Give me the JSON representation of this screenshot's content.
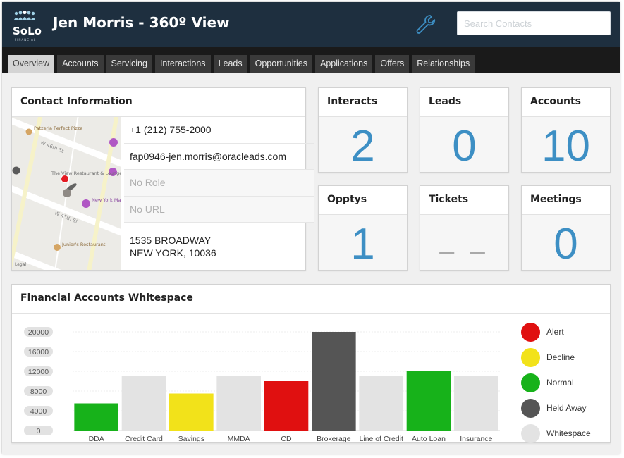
{
  "header": {
    "logo_text": "SoLo",
    "logo_sub": "FINANCIAL",
    "title": "Jen Morris - 360º View",
    "search_placeholder": "Search Contacts"
  },
  "tabs": [
    {
      "label": "Overview",
      "active": true
    },
    {
      "label": "Accounts",
      "active": false
    },
    {
      "label": "Servicing",
      "active": false
    },
    {
      "label": "Interactions",
      "active": false
    },
    {
      "label": "Leads",
      "active": false
    },
    {
      "label": "Opportunities",
      "active": false
    },
    {
      "label": "Applications",
      "active": false
    },
    {
      "label": "Offers",
      "active": false
    },
    {
      "label": "Relationships",
      "active": false
    }
  ],
  "contact": {
    "title": "Contact Information",
    "phone": "+1 (212) 755-2000",
    "email": "fap0946-jen.morris@oracleads.com",
    "role": "No Role",
    "url": "No URL",
    "address_line1": "1535 BROADWAY",
    "address_line2": "NEW YORK, 10036",
    "map": {
      "places": [
        "Patzeria Perfect Pizza",
        "The View Restaurant & Lounge",
        "New York Marriott",
        "Junior's Restaurant"
      ],
      "streets": [
        "W 46th St",
        "W 45th St"
      ],
      "attribution": "Legal"
    }
  },
  "stats": {
    "interacts": {
      "label": "Interacts",
      "value": "2"
    },
    "leads": {
      "label": "Leads",
      "value": "0"
    },
    "accounts": {
      "label": "Accounts",
      "value": "10"
    },
    "opptys": {
      "label": "Opptys",
      "value": "1"
    },
    "tickets": {
      "label": "Tickets",
      "value": "– –"
    },
    "meetings": {
      "label": "Meetings",
      "value": "0"
    }
  },
  "whitespace": {
    "title": "Financial Accounts Whitespace"
  },
  "chart_data": {
    "type": "bar",
    "categories": [
      "DDA",
      "Credit Card",
      "Savings",
      "MMDA",
      "CD",
      "Brokerage",
      "Line of Credit",
      "Auto Loan",
      "Insurance"
    ],
    "values": [
      5500,
      11000,
      7500,
      11000,
      10000,
      20000,
      11000,
      12000,
      11000
    ],
    "statuses": [
      "Normal",
      "Whitespace",
      "Decline",
      "Whitespace",
      "Alert",
      "Held Away",
      "Whitespace",
      "Normal",
      "Whitespace"
    ],
    "yticks": [
      "20000",
      "16000",
      "12000",
      "8000",
      "4000",
      "0"
    ],
    "ylim": [
      0,
      20000
    ],
    "legend": [
      {
        "label": "Alert",
        "color": "#e01010"
      },
      {
        "label": "Decline",
        "color": "#f2e21a"
      },
      {
        "label": "Normal",
        "color": "#17b21a"
      },
      {
        "label": "Held Away",
        "color": "#555555"
      },
      {
        "label": "Whitespace",
        "color": "#e3e3e3"
      }
    ],
    "legend_position": "right",
    "grid": true
  },
  "colors": {
    "header_bg": "#1e2f3f",
    "tabbar_bg": "#1a1a1a",
    "accent_blue": "#3d8fc4"
  }
}
